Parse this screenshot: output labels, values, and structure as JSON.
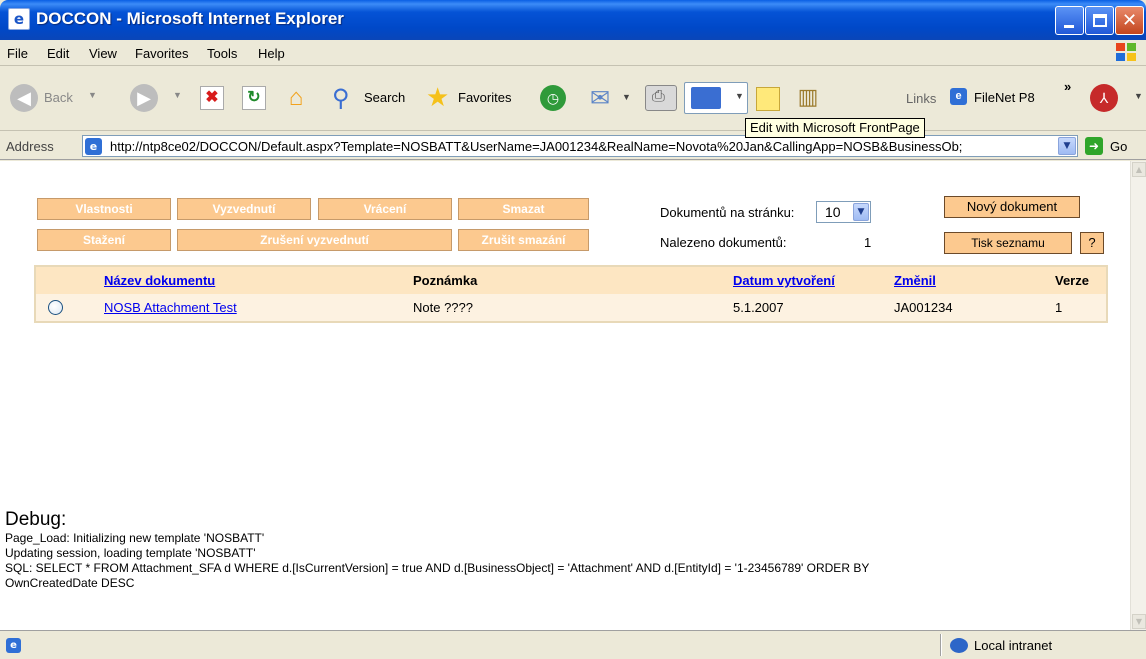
{
  "window": {
    "title": "DOCCON - Microsoft Internet Explorer"
  },
  "menu": [
    "File",
    "Edit",
    "View",
    "Favorites",
    "Tools",
    "Help"
  ],
  "toolbar": {
    "back": "Back",
    "search": "Search",
    "favorites": "Favorites",
    "links": "Links",
    "filenet": "FileNet P8",
    "chevron": "»"
  },
  "tooltip": "Edit with Microsoft FrontPage",
  "address": {
    "label": "Address",
    "url": "http://ntp8ce02/DOCCON/Default.aspx?Template=NOSBATT&UserName=JA001234&RealName=Novota%20Jan&CallingApp=NOSB&BusinessOb;",
    "go": "Go"
  },
  "actions": {
    "vlastnosti": "Vlastnosti",
    "vyzvednuti": "Vyzvednutí",
    "vraceni": "Vrácení",
    "smazat": "Smazat",
    "stazeni": "Stažení",
    "zruseni_vyzvednuti": "Zrušení vyzvednutí",
    "zrusit_smazani": "Zrušit smazání",
    "novy_dokument": "Nový dokument",
    "tisk_seznamu": "Tisk seznamu",
    "help": "?"
  },
  "paging": {
    "per_page_label": "Dokumentů na stránku:",
    "per_page_value": "10",
    "found_label": "Nalezeno dokumentů:",
    "found_value": "1"
  },
  "table": {
    "columns": {
      "name": "Název dokumentu",
      "note": "Poznámka",
      "created": "Datum vytvoření",
      "changed": "Změnil",
      "version": "Verze"
    },
    "rows": [
      {
        "name": "NOSB Attachment Test",
        "note": "Note ????",
        "created": "5.1.2007",
        "changed": "JA001234",
        "version": "1"
      }
    ]
  },
  "debug": {
    "title": "Debug:",
    "lines": [
      "Page_Load: Initializing new template 'NOSBATT'",
      "Updating session, loading template 'NOSBATT'",
      "SQL: SELECT * FROM Attachment_SFA d WHERE d.[IsCurrentVersion] = true AND d.[BusinessObject] = 'Attachment' AND d.[EntityId] = '1-23456789' ORDER BY",
      "OwnCreatedDate DESC"
    ]
  },
  "status": {
    "zone": "Local intranet"
  }
}
